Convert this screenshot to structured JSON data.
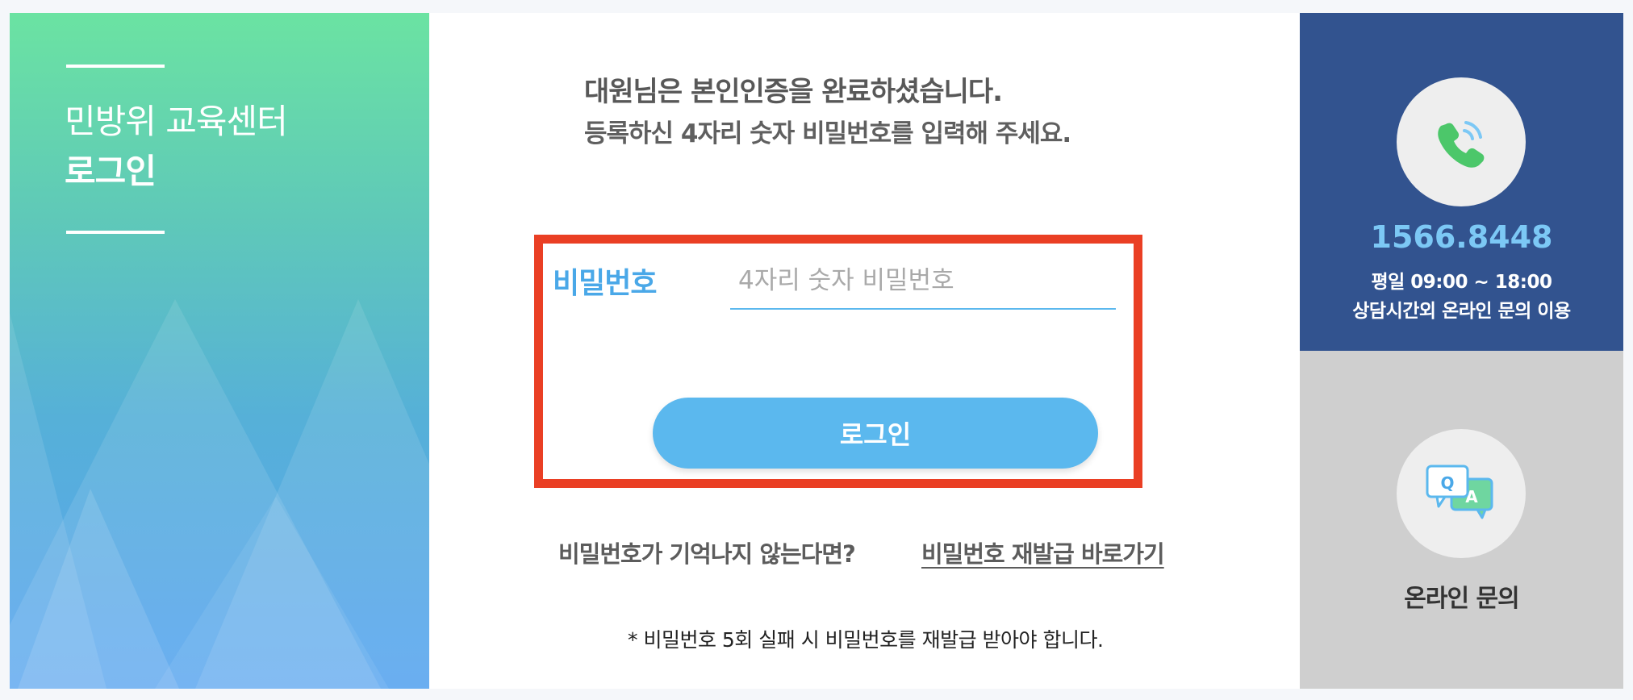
{
  "left_panel": {
    "subtitle": "민방위 교육센터",
    "title": "로그인"
  },
  "notice": {
    "line1": "대원님은 본인인증을 완료하셨습니다.",
    "line2": "등록하신 4자리 숫자 비밀번호를 입력해 주세요."
  },
  "form": {
    "password_label": "비밀번호",
    "password_placeholder": "4자리 숫자 비밀번호",
    "login_button": "로그인"
  },
  "forgot": {
    "question": "비밀번호가 기억나지 않는다면?",
    "link": "비밀번호 재발급 바로가기"
  },
  "warning": "* 비밀번호 5회 실패 시 비밀번호를 재발급 받아야 합니다.",
  "contact": {
    "phone": "1566.8448",
    "hours_line1": "평일 09:00 ~ 18:00",
    "hours_line2": "상담시간외 온라인 문의 이용"
  },
  "online_inquiry": {
    "label": "온라인 문의"
  },
  "icons": {
    "phone": "phone-icon",
    "qa": "qa-chat-icon"
  },
  "colors": {
    "accent_blue": "#5bb8ee",
    "highlight_red": "#ea3f24",
    "navy": "#32538f",
    "phone_green": "#4cc76a"
  }
}
